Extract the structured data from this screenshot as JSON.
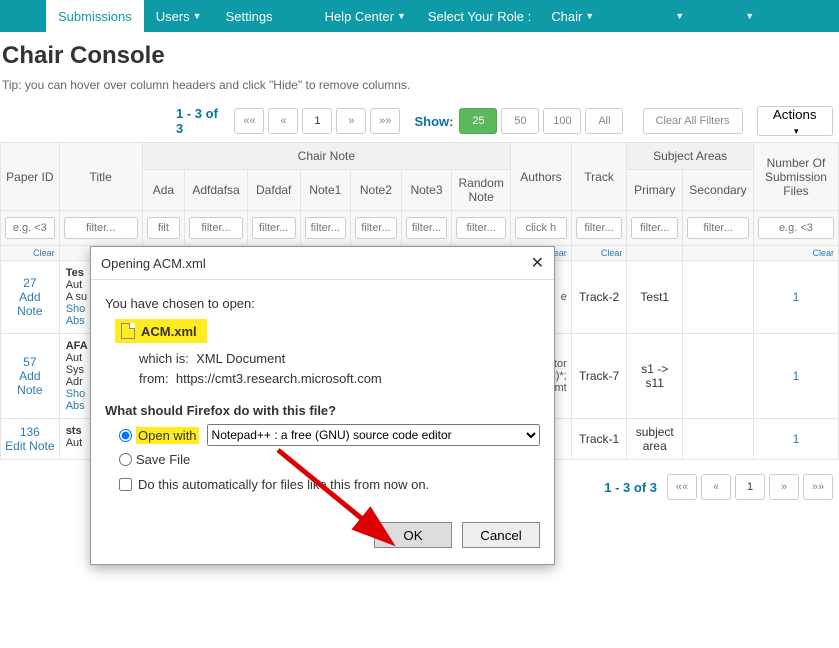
{
  "topbar": {
    "submissions": "Submissions",
    "users": "Users",
    "settings": "Settings",
    "help": "Help Center",
    "select_role": "Select Your Role :",
    "role": "Chair"
  },
  "page": {
    "title": "Chair Console",
    "tip": "Tip: you can hover over column headers and click \"Hide\" to remove columns.",
    "range": "1 - 3 of 3",
    "show": "Show:",
    "page_sizes": [
      "25",
      "50",
      "100",
      "All"
    ],
    "clear_all": "Clear All Filters",
    "actions": "Actions"
  },
  "cols": {
    "paper_id": "Paper ID",
    "title": "Title",
    "chair_note": "Chair Note",
    "authors": "Authors",
    "track": "Track",
    "subject": "Subject Areas",
    "num_files": "Number Of Submission Files",
    "ada": "Ada",
    "adf": "Adfdafsa",
    "dafdaf": "Dafdaf",
    "n1": "Note1",
    "n2": "Note2",
    "n3": "Note3",
    "rn": "Random Note",
    "primary": "Primary",
    "secondary": "Secondary"
  },
  "filters": {
    "ph_eg": "e.g. <3",
    "ph_filter": "filter...",
    "ph_filt": "filt",
    "ph_click": "click h",
    "clear": "Clear"
  },
  "rows": [
    {
      "id": "27",
      "add": "Add Note",
      "title_lines": [
        "Tes",
        "Aut",
        "A su",
        "Sho",
        "Abs"
      ],
      "track": "Track-2",
      "primary": "Test1",
      "secondary": "",
      "files": "1",
      "author_hint": "e"
    },
    {
      "id": "57",
      "add": "Add Note",
      "title_lines": [
        "AFA",
        "Aut",
        "Sys",
        "Adr",
        "Sho",
        "Abs"
      ],
      "track": "Track-7",
      "primary": "s1 -> s11",
      "secondary": "",
      "files": "1",
      "author_hint": "ator\nft)*;\ncmt"
    },
    {
      "id": "136",
      "add": "Edit Note",
      "title_lines": [
        "sts",
        "Aut"
      ],
      "track": "Track-1",
      "primary": "subject area",
      "secondary": "",
      "files": "1",
      "author_hint": ""
    }
  ],
  "dialog": {
    "title": "Opening ACM.xml",
    "chosen": "You have chosen to open:",
    "filename": "ACM.xml",
    "which_is_lbl": "which is:",
    "which_is": "XML Document",
    "from_lbl": "from:",
    "from": "https://cmt3.research.microsoft.com",
    "question": "What should Firefox do with this file?",
    "open_with": "Open with",
    "handler": "Notepad++ : a free (GNU) source code editor",
    "save": "Save File",
    "auto": "Do this automatically for files like this from now on.",
    "ok": "OK",
    "cancel": "Cancel"
  }
}
